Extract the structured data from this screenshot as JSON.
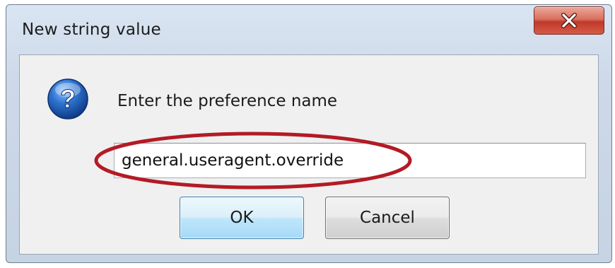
{
  "dialog": {
    "title": "New string value",
    "prompt": "Enter the preference name",
    "input_value": "general.useragent.override",
    "ok_label": "OK",
    "cancel_label": "Cancel"
  },
  "icons": {
    "close": "close-icon",
    "question": "question-icon"
  },
  "colors": {
    "highlight": "#b31b24",
    "close_button": "#c0392b",
    "question_icon": "#1f5fb3"
  }
}
